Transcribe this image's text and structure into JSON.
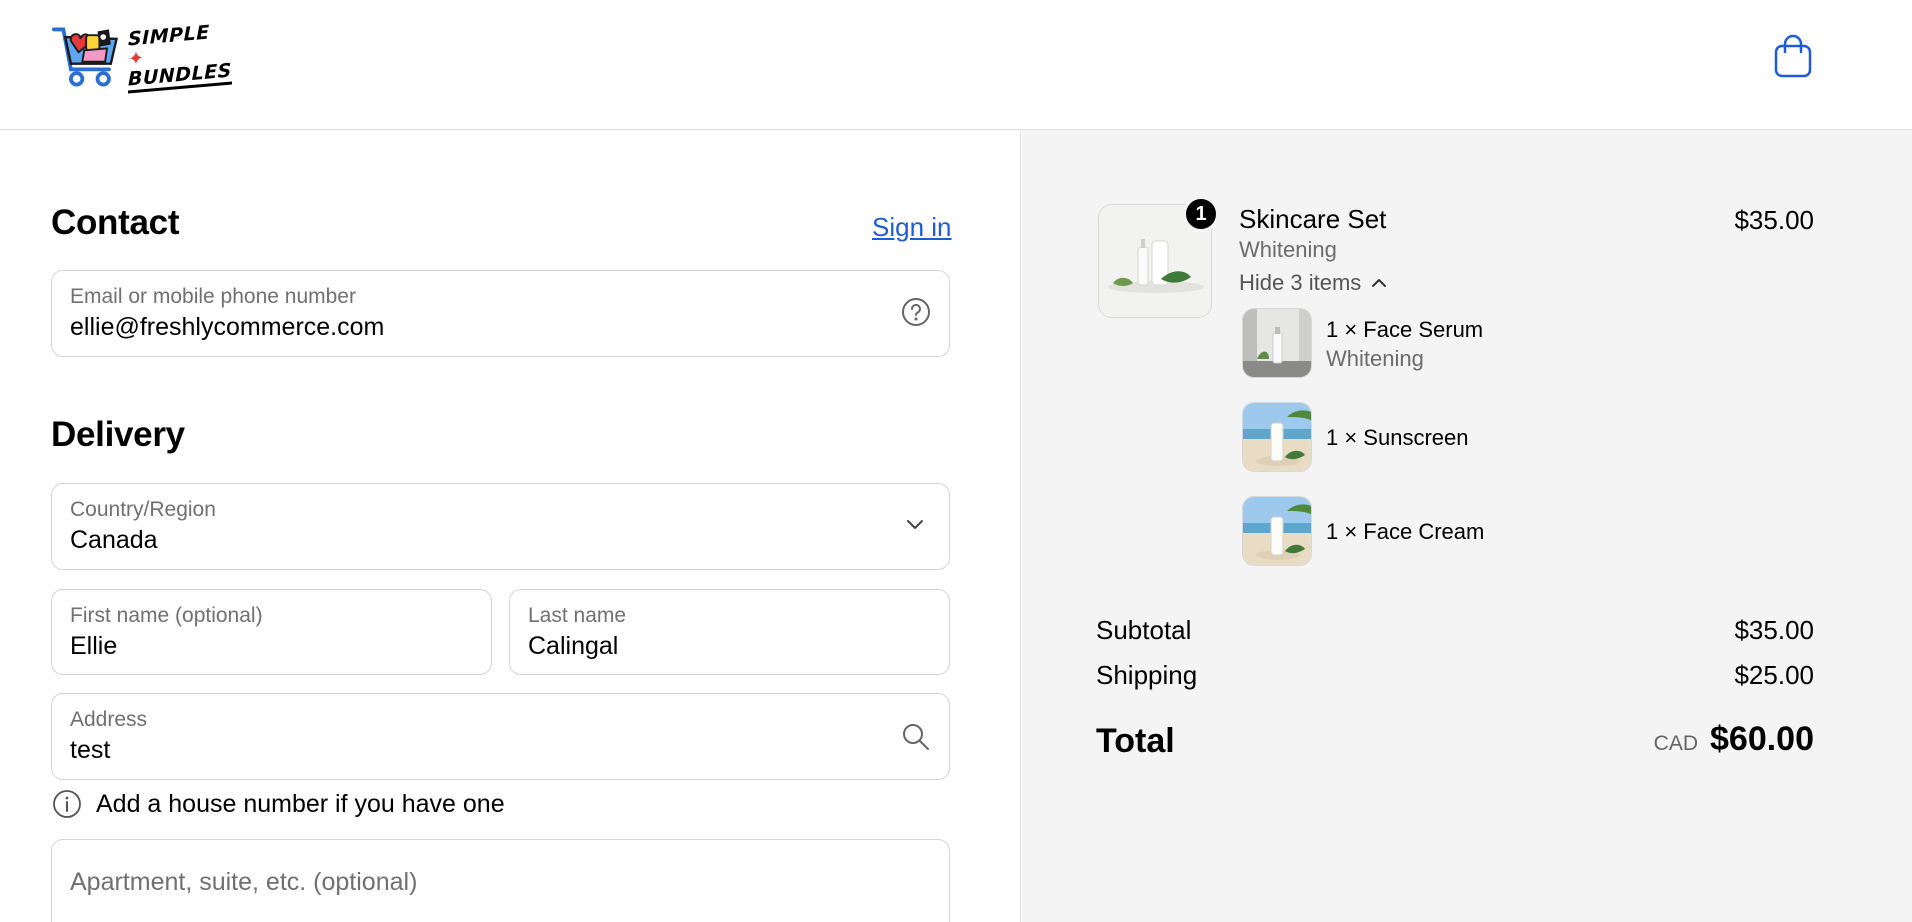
{
  "header": {
    "logo": {
      "line1": "SIMPLE",
      "line2": "BUNDLES",
      "star": "✦",
      "icon": "shopping-cart-logo-icon"
    },
    "cart_icon": "shopping-bag-icon"
  },
  "contact": {
    "title": "Contact",
    "sign_in": "Sign in",
    "email_label": "Email or mobile phone number",
    "email_value": "ellie@freshlycommerce.com",
    "help_icon": "question-circle-icon"
  },
  "delivery": {
    "title": "Delivery",
    "country_label": "Country/Region",
    "country_value": "Canada",
    "first_name_label": "First name (optional)",
    "first_name_value": "Ellie",
    "last_name_label": "Last name",
    "last_name_value": "Calingal",
    "address_label": "Address",
    "address_value": "test",
    "address_hint": "Add a house number if you have one",
    "apartment_placeholder": "Apartment, suite, etc. (optional)"
  },
  "summary": {
    "product": {
      "quantity": "1",
      "name": "Skincare Set",
      "variant": "Whitening",
      "price": "$35.00",
      "toggle_label": "Hide 3 items"
    },
    "items": [
      {
        "name": "1 × Face Serum",
        "variant": "Whitening"
      },
      {
        "name": "1 × Sunscreen"
      },
      {
        "name": "1 × Face Cream"
      }
    ],
    "subtotal_label": "Subtotal",
    "subtotal_value": "$35.00",
    "shipping_label": "Shipping",
    "shipping_value": "$25.00",
    "total_label": "Total",
    "total_currency": "CAD",
    "total_value": "$60.00"
  },
  "colors": {
    "link": "#1f5bd6",
    "summary_bg": "#f4f4f4",
    "border": "#d6d6d6"
  }
}
